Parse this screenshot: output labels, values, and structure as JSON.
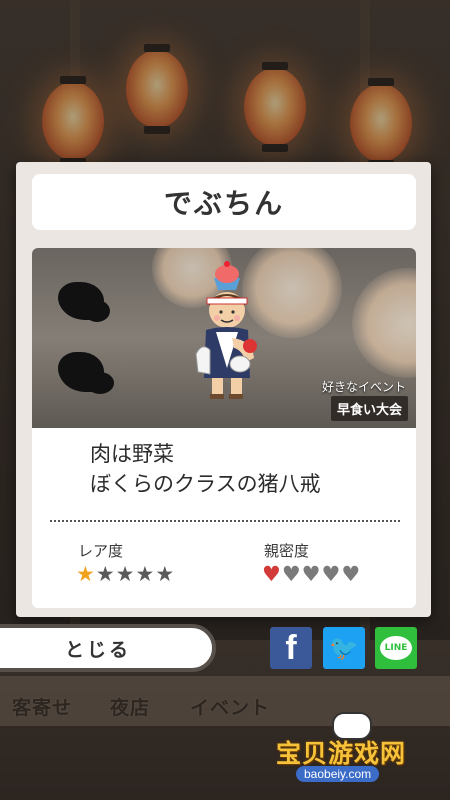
{
  "dialog": {
    "title": "でぶちん",
    "favorite_event_label": "好きなイベント",
    "favorite_event": "早食い大会",
    "description_line1": "肉は野菜",
    "description_line2": "ぼくらのクラスの猪八戒",
    "rarity_label": "レア度",
    "rarity_value": 1,
    "rarity_max": 5,
    "intimacy_label": "親密度",
    "intimacy_value": 1,
    "intimacy_max": 5
  },
  "actions": {
    "close_label": "とじる",
    "share_facebook_icon": "f",
    "share_twitter_icon": "🐦",
    "share_line_label": "LINE"
  },
  "bottom_nav": {
    "items": [
      "客寄せ",
      "夜店",
      "イベント"
    ]
  },
  "watermark": {
    "text": "宝贝游戏网",
    "url": "baobeiy.com"
  },
  "colors": {
    "facebook": "#3b5998",
    "twitter": "#1da1f2",
    "line": "#2fbf3d",
    "star_active": "#f0a21e",
    "heart_active": "#d23a3a"
  }
}
